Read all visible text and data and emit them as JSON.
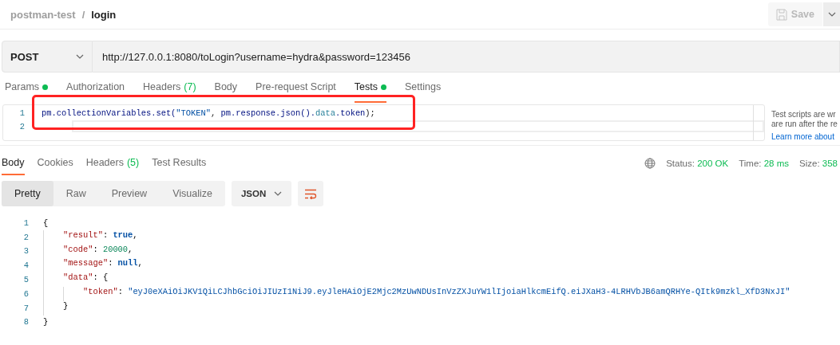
{
  "breadcrumb": {
    "collection": "postman-test",
    "separator": "/",
    "request": "login"
  },
  "save_button": {
    "label": "Save",
    "disabled": true
  },
  "request": {
    "method": "POST",
    "url": "http://127.0.0.1:8080/toLogin?username=hydra&password=123456"
  },
  "request_tabs": [
    {
      "label": "Params",
      "dot": true,
      "selected": false
    },
    {
      "label": "Authorization",
      "dot": false,
      "selected": false
    },
    {
      "label": "Headers",
      "count": "(7)",
      "dot": false,
      "selected": false
    },
    {
      "label": "Body",
      "dot": false,
      "selected": false
    },
    {
      "label": "Pre-request Script",
      "dot": false,
      "selected": false
    },
    {
      "label": "Tests",
      "dot": true,
      "selected": true
    },
    {
      "label": "Settings",
      "dot": false,
      "selected": false
    }
  ],
  "test_editor": {
    "lines": [
      {
        "number": "1",
        "tokens": [
          {
            "kind": "ident",
            "text": "pm.collectionVariables.set("
          },
          {
            "kind": "string",
            "text": "\"TOKEN\""
          },
          {
            "kind": "plain",
            "text": ", "
          },
          {
            "kind": "ident",
            "text": "pm.response.json()."
          },
          {
            "kind": "prop",
            "text": "data"
          },
          {
            "kind": "ident",
            "text": ".token"
          },
          {
            "kind": "plain",
            "text": ");"
          }
        ]
      },
      {
        "number": "2"
      }
    ],
    "hint_lines": [
      "Test scripts are wr",
      "are run after the re"
    ],
    "link": "Learn more about"
  },
  "response_tabs": [
    {
      "label": "Body",
      "selected": true
    },
    {
      "label": "Cookies",
      "selected": false
    },
    {
      "label": "Headers",
      "count": "(5)",
      "selected": false
    },
    {
      "label": "Test Results",
      "selected": false
    }
  ],
  "response_meta": [
    {
      "label": "Status:",
      "value": "200 OK"
    },
    {
      "label": "Time:",
      "value": "28 ms"
    },
    {
      "label": "Size:",
      "value": "358"
    }
  ],
  "view_modes": [
    {
      "label": "Pretty",
      "selected": true
    },
    {
      "label": "Raw",
      "selected": false
    },
    {
      "label": "Preview",
      "selected": false
    },
    {
      "label": "Visualize",
      "selected": false
    }
  ],
  "format": "JSON",
  "response_lines": [
    {
      "number": "1",
      "tokens": [
        {
          "kind": "punct",
          "text": "{"
        }
      ],
      "children": [
        {
          "number": "2",
          "tokens": [
            {
              "kind": "key",
              "text": "\"result\""
            },
            {
              "kind": "punct",
              "text": ": "
            },
            {
              "kind": "keyword",
              "text": "true"
            },
            {
              "kind": "punct",
              "text": ","
            }
          ]
        },
        {
          "number": "3",
          "tokens": [
            {
              "kind": "key",
              "text": "\"code\""
            },
            {
              "kind": "punct",
              "text": ": "
            },
            {
              "kind": "number",
              "text": "20000"
            },
            {
              "kind": "punct",
              "text": ","
            }
          ]
        },
        {
          "number": "4",
          "tokens": [
            {
              "kind": "key",
              "text": "\"message\""
            },
            {
              "kind": "punct",
              "text": ": "
            },
            {
              "kind": "keyword",
              "text": "null"
            },
            {
              "kind": "punct",
              "text": ","
            }
          ]
        },
        {
          "number": "5",
          "tokens": [
            {
              "kind": "key",
              "text": "\"data\""
            },
            {
              "kind": "punct",
              "text": ": {"
            }
          ],
          "children": [
            {
              "number": "6",
              "tokens": [
                {
                  "kind": "key",
                  "text": "\"token\""
                },
                {
                  "kind": "punct",
                  "text": ": "
                },
                {
                  "kind": "string",
                  "text": "\"eyJ0eXAiOiJKV1QiLCJhbGciOiJIUzI1NiJ9.eyJleHAiOjE2Mjc2MzUwNDUsInVzZXJuYW1lIjoiaHlkcmEifQ.eiJXaH3-4LRHVbJB6amQRHYe-QItk9mzkl_XfD3NxJI\""
                }
              ]
            }
          ]
        },
        {
          "number": "7",
          "tokens": [
            {
              "kind": "punct",
              "text": "}"
            }
          ]
        }
      ]
    },
    {
      "number": "8",
      "tokens": [
        {
          "kind": "punct",
          "text": "}"
        }
      ]
    }
  ]
}
